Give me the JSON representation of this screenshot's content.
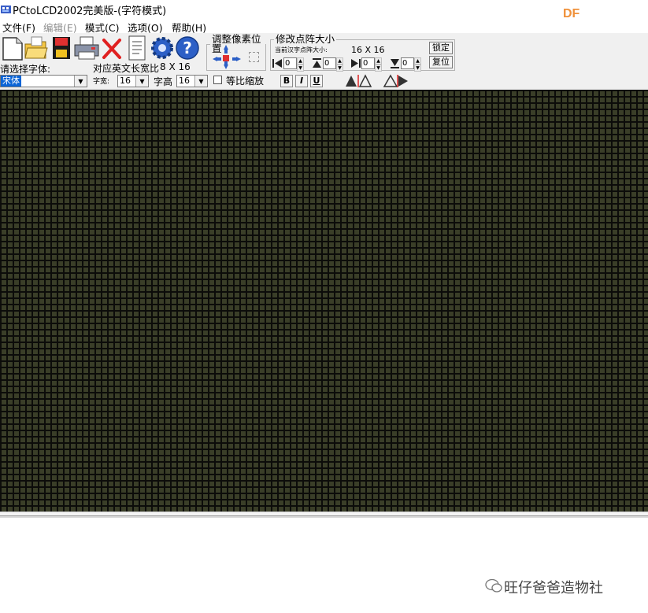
{
  "window": {
    "title": "PCtoLCD2002完美版-(字符模式)"
  },
  "watermark": {
    "corner": "DF",
    "brand": "旺仔爸爸造物社"
  },
  "menu": [
    {
      "label": "文件(F)",
      "disabled": false
    },
    {
      "label": "编辑(E)",
      "disabled": true
    },
    {
      "label": "模式(C)",
      "disabled": false
    },
    {
      "label": "选项(O)",
      "disabled": false
    },
    {
      "label": "帮助(H)",
      "disabled": false
    }
  ],
  "toolbar": {
    "buttons": [
      "new-icon",
      "open-icon",
      "save-icon",
      "print-icon",
      "delete-icon",
      "document-icon",
      "settings-gear-icon",
      "help-icon"
    ]
  },
  "font": {
    "select_label": "请选择字体:",
    "font_value": "宋体",
    "ratio_label": "对应英文长宽比",
    "ratio_value": "8 X 16",
    "width_label": "字宽:",
    "width_value": "16",
    "height_label": "字高",
    "height_value": "16",
    "proportional_label": "等比缩放"
  },
  "pixel_position": {
    "legend": "调整像素位置"
  },
  "matrix_size": {
    "legend": "修改点阵大小",
    "current_label": "当前汉字点阵大小:",
    "current_value": "16 X 16",
    "lock_button": "锁定",
    "reset_button": "复位",
    "spinners": [
      {
        "name": "left",
        "value": "0"
      },
      {
        "name": "top",
        "value": "0"
      },
      {
        "name": "right",
        "value": "0"
      },
      {
        "name": "bottom",
        "value": "0"
      }
    ]
  },
  "format": {
    "bold": "B",
    "italic": "I",
    "underline": "U"
  },
  "colors": {
    "matrix_dot": "#3a3e28",
    "matrix_grid": "#0c0c0a",
    "selection": "#0a64d6",
    "watermark": "#f0913a"
  }
}
